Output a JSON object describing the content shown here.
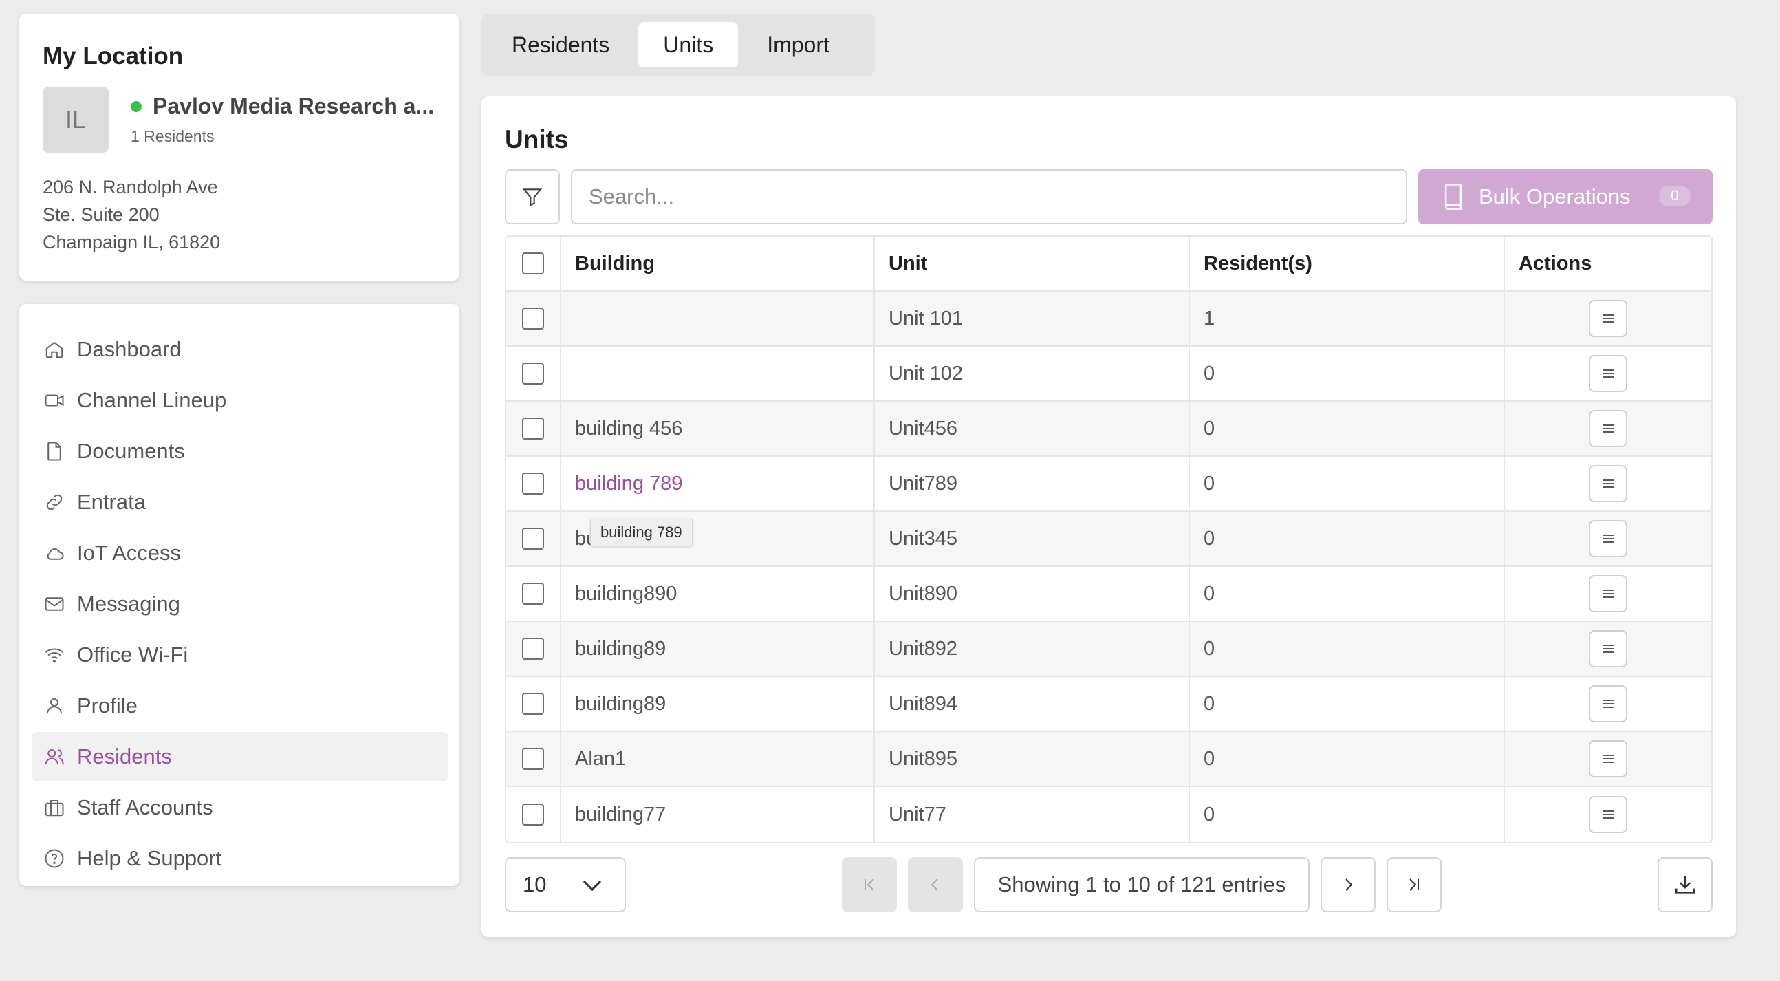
{
  "location": {
    "heading": "My Location",
    "avatar_initials": "IL",
    "name": "Pavlov Media Research a...",
    "residents": "1 Residents",
    "status_color": "#35c04a",
    "address": [
      "206 N. Randolph Ave",
      "Ste. Suite 200",
      "Champaign IL, 61820"
    ]
  },
  "nav": {
    "items": [
      {
        "label": "Dashboard",
        "icon": "home-icon"
      },
      {
        "label": "Channel Lineup",
        "icon": "video-icon"
      },
      {
        "label": "Documents",
        "icon": "document-icon"
      },
      {
        "label": "Entrata",
        "icon": "link-icon"
      },
      {
        "label": "IoT Access",
        "icon": "cloud-icon"
      },
      {
        "label": "Messaging",
        "icon": "mail-icon"
      },
      {
        "label": "Office Wi-Fi",
        "icon": "wifi-icon"
      },
      {
        "label": "Profile",
        "icon": "user-icon"
      },
      {
        "label": "Residents",
        "icon": "users-icon",
        "active": true
      },
      {
        "label": "Staff Accounts",
        "icon": "briefcase-icon"
      },
      {
        "label": "Help & Support",
        "icon": "help-icon"
      }
    ],
    "accent_color": "#9a4f9e"
  },
  "tabs": [
    {
      "label": "Residents"
    },
    {
      "label": "Units",
      "active": true
    },
    {
      "label": "Import"
    }
  ],
  "units": {
    "title": "Units",
    "search_placeholder": "Search...",
    "bulk_label": "Bulk Operations",
    "bulk_count": "0",
    "bulk_color": "#d0a8d3",
    "columns": [
      "Building",
      "Unit",
      "Resident(s)",
      "Actions"
    ],
    "rows": [
      {
        "building": "",
        "unit": "Unit 101",
        "residents": "1"
      },
      {
        "building": "",
        "unit": "Unit 102",
        "residents": "0"
      },
      {
        "building": "building 456",
        "unit": "Unit456",
        "residents": "0"
      },
      {
        "building": "building 789",
        "unit": "Unit789",
        "residents": "0",
        "hovered": true
      },
      {
        "building": "bu",
        "unit": "Unit345",
        "residents": "0"
      },
      {
        "building": "building890",
        "unit": "Unit890",
        "residents": "0"
      },
      {
        "building": "building89",
        "unit": "Unit892",
        "residents": "0"
      },
      {
        "building": "building89",
        "unit": "Unit894",
        "residents": "0"
      },
      {
        "building": "Alan1",
        "unit": "Unit895",
        "residents": "0"
      },
      {
        "building": "building77",
        "unit": "Unit77",
        "residents": "0"
      }
    ],
    "tooltip": "building 789",
    "page_size": "10",
    "pagination_info": "Showing 1 to 10 of 121 entries"
  }
}
